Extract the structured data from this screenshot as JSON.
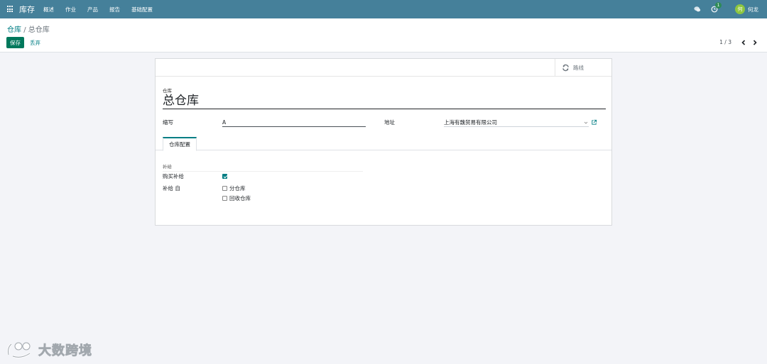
{
  "navbar": {
    "app_name": "库存",
    "menu": [
      "概述",
      "作业",
      "产品",
      "报告",
      "基础配置"
    ],
    "activity_count": "1",
    "user_avatar": "何",
    "user_name": "何龙"
  },
  "breadcrumb": {
    "parent": "仓库",
    "separator": "/",
    "current": "总仓库"
  },
  "actions": {
    "save_label": "保存",
    "discard_label": "丢弃"
  },
  "pager": {
    "value": "1 / 3"
  },
  "form": {
    "routes_button_label": "路线",
    "name_label": "仓库",
    "name_value": "总仓库",
    "code_label": "缩写",
    "code_value": "A",
    "address_label": "地址",
    "address_value": "上海有魏贸易有限公司",
    "tab_label": "仓库配置",
    "group_title": "补给",
    "buy_resupply_label": "购买补给",
    "buy_resupply_checked": true,
    "resupply_from_label": "补给 自",
    "resupply_options": [
      {
        "label": "分仓库",
        "checked": false
      },
      {
        "label": "回收仓库",
        "checked": false
      }
    ]
  },
  "watermark": {
    "text": "大数跨境"
  },
  "colors": {
    "navbar": "#45809a",
    "primary": "#00785c",
    "link": "#017e84"
  }
}
